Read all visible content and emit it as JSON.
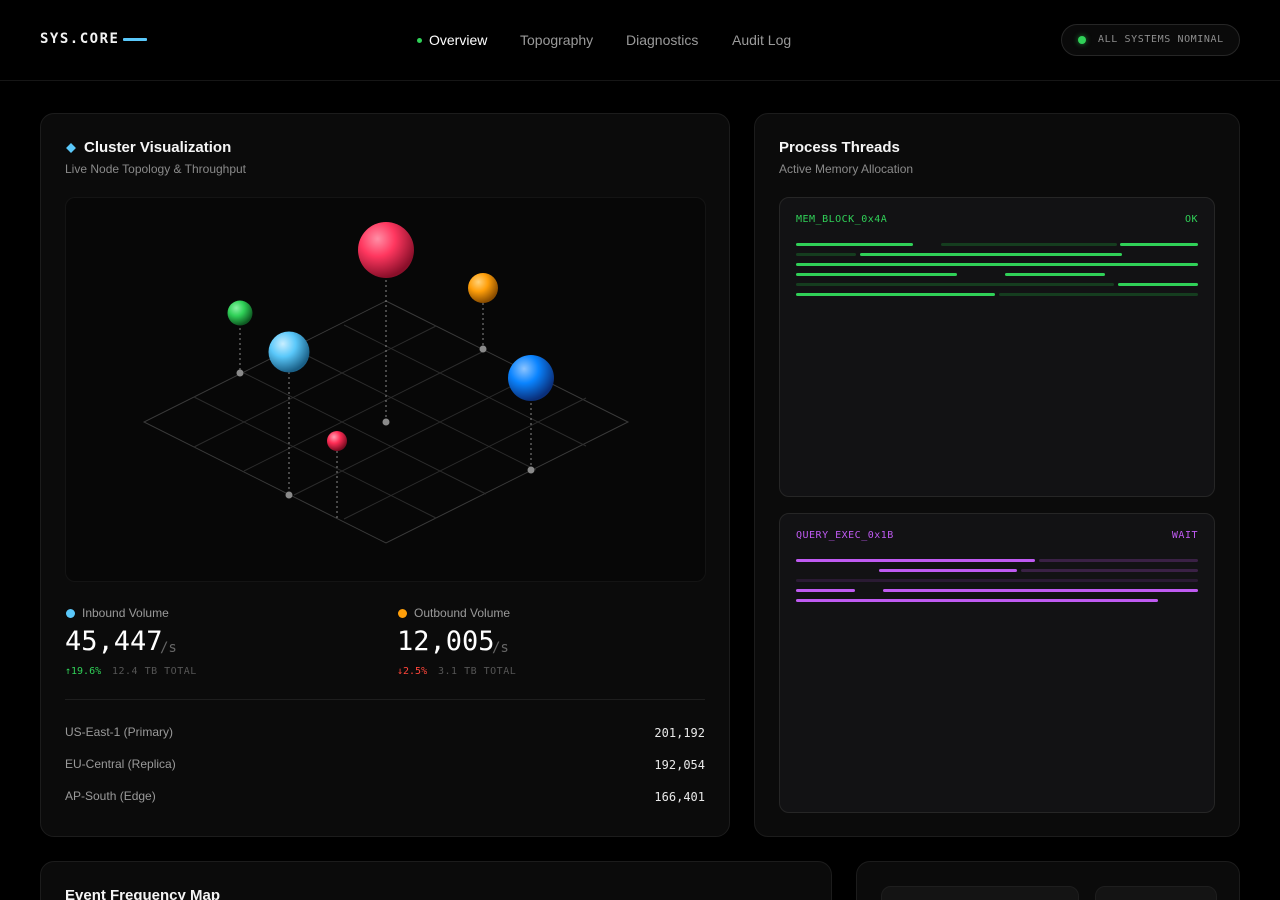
{
  "brand": {
    "name": "SYS.CORE"
  },
  "nav": {
    "items": [
      {
        "label": "Overview",
        "active": true
      },
      {
        "label": "Topography",
        "active": false
      },
      {
        "label": "Diagnostics",
        "active": false
      },
      {
        "label": "Audit Log",
        "active": false
      }
    ]
  },
  "status": {
    "label": "ALL SYSTEMS NOMINAL",
    "color": "#30d158"
  },
  "cluster": {
    "title": "Cluster Visualization",
    "subtitle": "Live Node Topology & Throughput",
    "title_icon": "diamond-icon",
    "accent": "#5ac8fa",
    "nodes_colors": [
      "#ff375f",
      "#ff9f0a",
      "#30d158",
      "#5ac8fa",
      "#0a84ff",
      "#ff2d55"
    ]
  },
  "metrics": {
    "inbound": {
      "label": "Inbound Volume",
      "value": "45,447",
      "unit": "/s",
      "change": "↑19.6%",
      "total": "12.4 TB TOTAL",
      "color": "#5ac8fa",
      "change_color": "#30d158"
    },
    "outbound": {
      "label": "Outbound Volume",
      "value": "12,005",
      "unit": "/s",
      "change": "↓2.5%",
      "total": "3.1 TB TOTAL",
      "color": "#ff9f0a",
      "change_color": "#ff453a"
    }
  },
  "regions": [
    {
      "label": "US-East-1 (Primary)",
      "value": "201,192"
    },
    {
      "label": "EU-Central (Replica)",
      "value": "192,054"
    },
    {
      "label": "AP-South (Edge)",
      "value": "166,401"
    }
  ],
  "process": {
    "title": "Process Threads",
    "subtitle": "Active Memory Allocation",
    "threads": [
      {
        "name": "MEM_BLOCK_0x4A",
        "status": "OK",
        "color": "#30d158"
      },
      {
        "name": "QUERY_EXEC_0x1B",
        "status": "WAIT",
        "color": "#bf5af2"
      }
    ]
  },
  "event_map": {
    "title": "Event Frequency Map"
  }
}
